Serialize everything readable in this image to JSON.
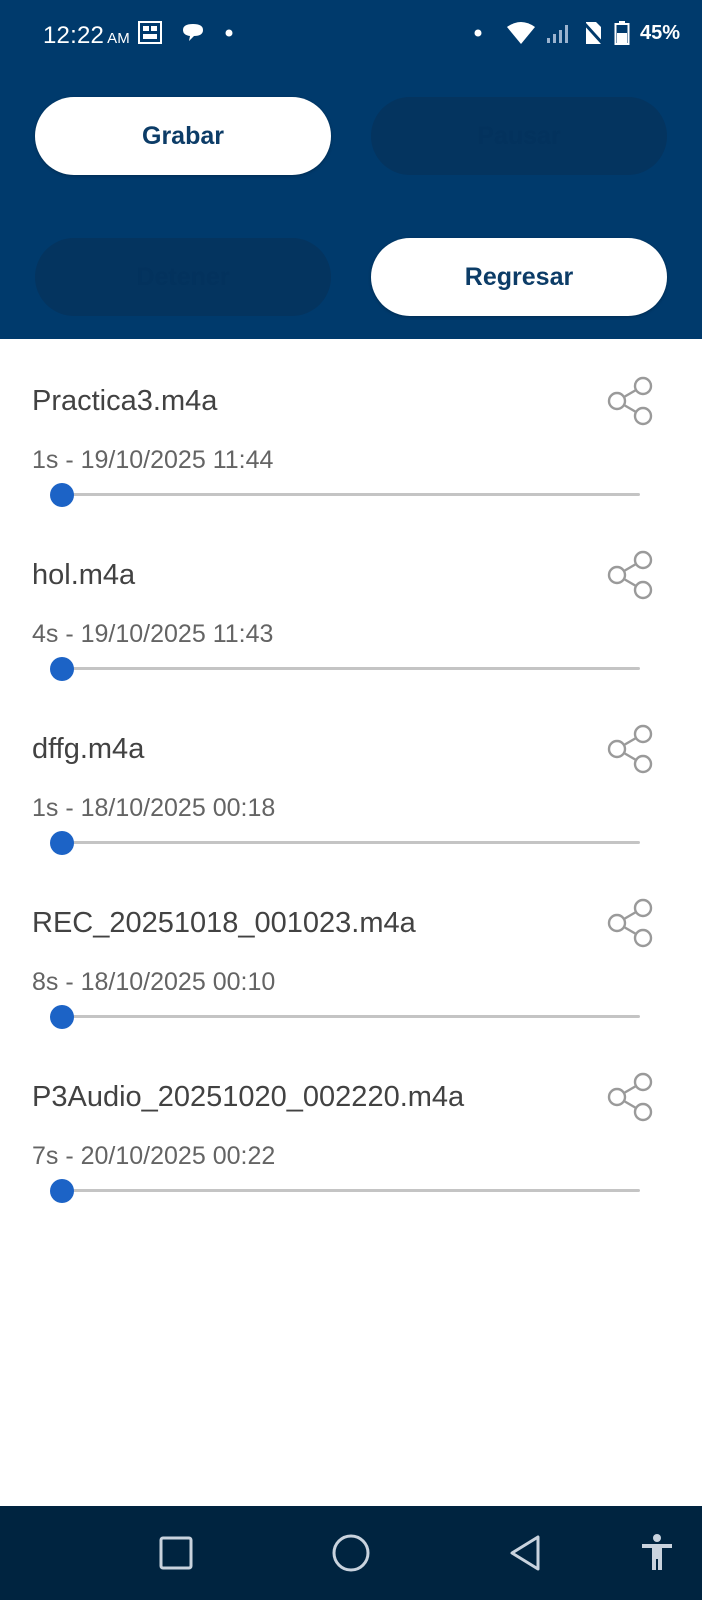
{
  "status_bar": {
    "time": "12:22",
    "ampm": "AM",
    "battery": "45%",
    "left_icons": [
      "gallery-icon",
      "chat-bubble-icon",
      "dot-icon"
    ],
    "right_icons": [
      "dot-icon",
      "wifi-icon",
      "signal-icon",
      "no-sim-icon",
      "battery-icon"
    ]
  },
  "controls": {
    "record_label": "Grabar",
    "pause_label": "Pausar",
    "stop_label": "Detener",
    "back_label": "Regresar"
  },
  "recordings": [
    {
      "name": "Practica3.m4a",
      "meta": "1s - 19/10/2025 11:44",
      "progress": 0
    },
    {
      "name": "hol.m4a",
      "meta": "4s - 19/10/2025 11:43",
      "progress": 0
    },
    {
      "name": "dffg.m4a",
      "meta": "1s - 18/10/2025 00:18",
      "progress": 0
    },
    {
      "name": "REC_20251018_001023.m4a",
      "meta": "8s - 18/10/2025 00:10",
      "progress": 0
    },
    {
      "name": "P3Audio_20251020_002220.m4a",
      "meta": "7s - 20/10/2025 00:22",
      "progress": 0
    }
  ],
  "nav_bar": {
    "buttons": [
      "recents-square-icon",
      "home-circle-icon",
      "back-triangle-icon",
      "accessibility-icon"
    ]
  },
  "colors": {
    "header": "#003a6c",
    "accent": "#1c63c6",
    "nav": "#002440"
  }
}
